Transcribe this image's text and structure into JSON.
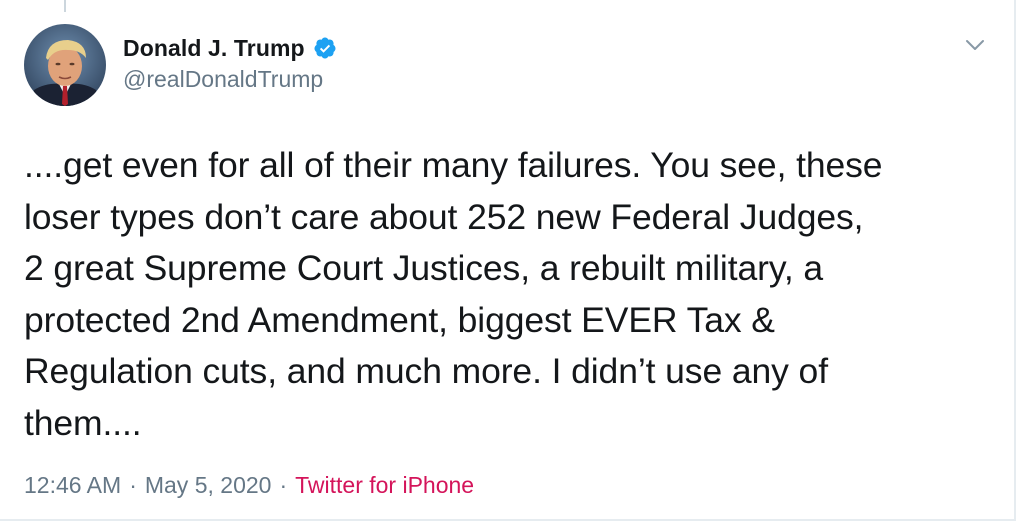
{
  "author": {
    "name": "Donald J. Trump",
    "handle": "@realDonaldTrump",
    "verified": true,
    "avatar_icon": "profile-photo"
  },
  "tweet": {
    "lines": [
      "....get even for all of their many failures. You see, these",
      "loser types don’t care about 252 new Federal Judges,",
      "2 great Supreme Court Justices, a rebuilt military, a",
      "protected 2nd Amendment, biggest EVER Tax &",
      "Regulation cuts, and much more. I didn’t use any of",
      "them...."
    ]
  },
  "meta": {
    "time": "12:46 AM",
    "separator": "·",
    "date": "May 5, 2020",
    "source": "Twitter for iPhone"
  },
  "colors": {
    "text_primary": "#14171a",
    "text_secondary": "#657786",
    "verified_badge": "#1da1f2",
    "source_link": "#d4145a",
    "border": "#e6ecf0"
  },
  "icons": {
    "verified": "verified-badge-icon",
    "menu": "chevron-down-icon"
  }
}
